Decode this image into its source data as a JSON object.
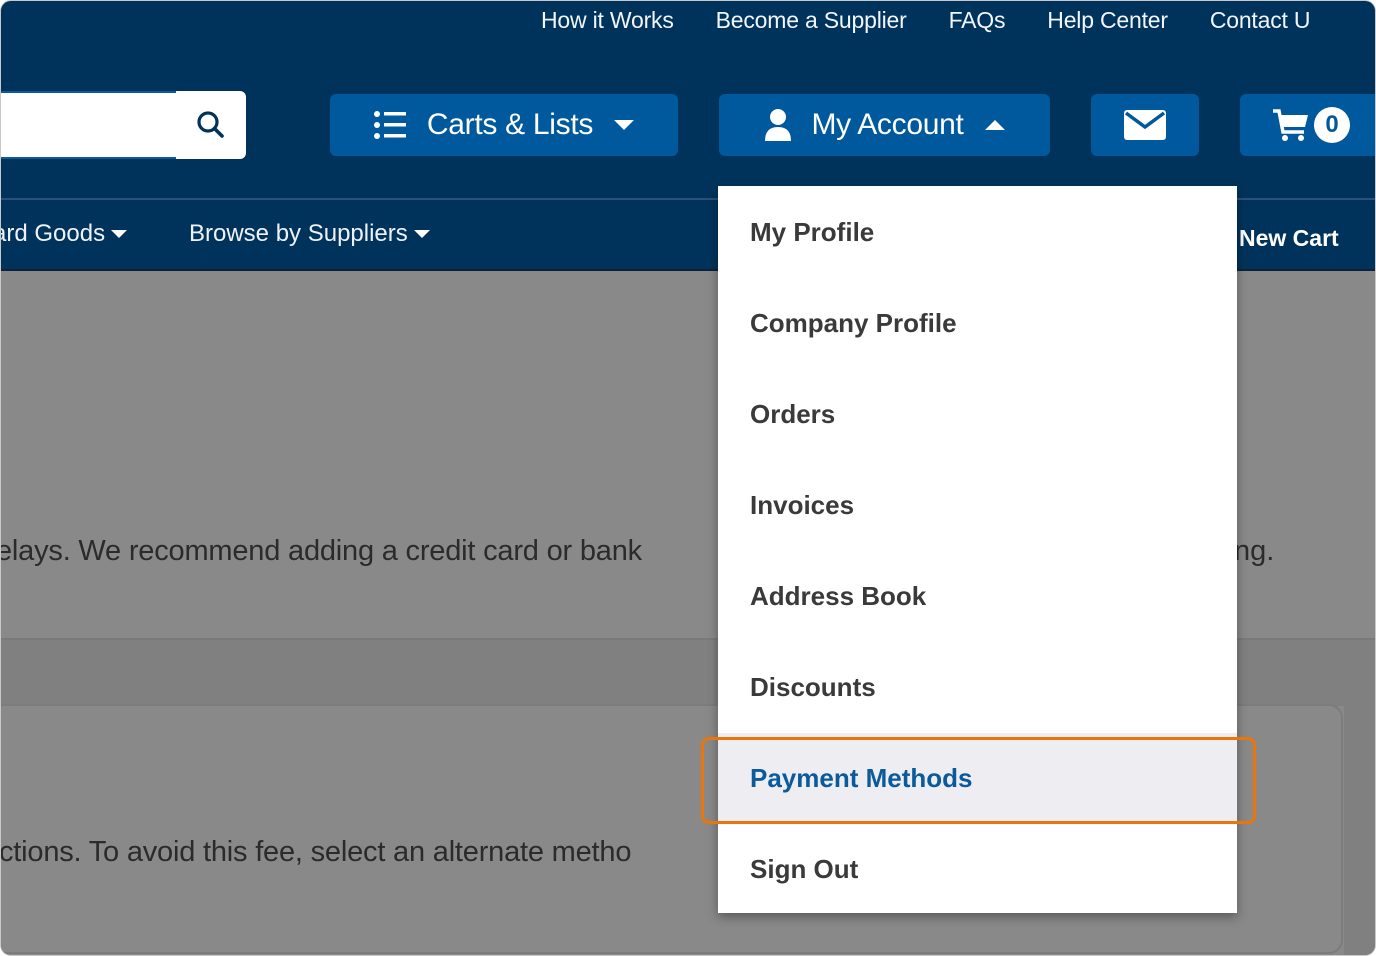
{
  "header": {
    "utility_nav": [
      "How it Works",
      "Become a Supplier",
      "FAQs",
      "Help Center",
      "Contact U"
    ],
    "search": {
      "value": "",
      "placeholder": "",
      "icon": "search-icon"
    },
    "carts_lists": {
      "label": "Carts & Lists",
      "icon": "list-icon",
      "caret": "caret-down-icon"
    },
    "my_account": {
      "label": "My Account",
      "icon": "user-icon",
      "caret": "caret-up-icon"
    },
    "messages": {
      "icon": "envelope-icon"
    },
    "cart": {
      "icon": "cart-icon",
      "count": "0"
    }
  },
  "category_nav": {
    "items": [
      {
        "label": "ard Goods",
        "caret": "caret-down-icon"
      },
      {
        "label": "Browse by Suppliers",
        "caret": "caret-down-icon"
      }
    ],
    "new_cart": "New Cart"
  },
  "content": {
    "alert_text_left": "elays. We recommend adding a credit card or bank",
    "alert_text_right": "ng.",
    "card_text": "ctions. To avoid this fee, select an alternate metho"
  },
  "account_menu": {
    "items": [
      {
        "label": "My Profile",
        "active": false
      },
      {
        "label": "Company Profile",
        "active": false
      },
      {
        "label": "Orders",
        "active": false
      },
      {
        "label": "Invoices",
        "active": false
      },
      {
        "label": "Address Book",
        "active": false
      },
      {
        "label": "Discounts",
        "active": false
      },
      {
        "label": "Payment Methods",
        "active": true
      },
      {
        "label": "Sign Out",
        "active": false
      }
    ],
    "highlighted_item": "Payment Methods"
  },
  "colors": {
    "header_bg": "#00335b",
    "button_bg": "#00599c",
    "link_active": "#0a5a9c",
    "highlight_outline": "#e8760a",
    "overlay_grey": "#898989"
  }
}
